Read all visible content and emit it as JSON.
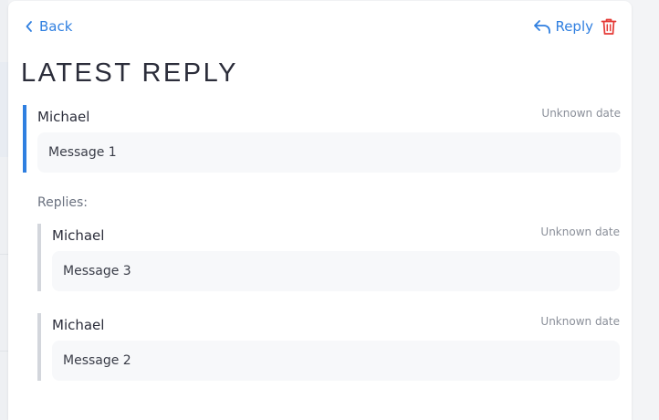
{
  "nav": {
    "back_label": "Back",
    "reply_label": "Reply",
    "accent_color": "#2f7fe0",
    "delete_color": "#e53935",
    "icons": {
      "back": "chevron-left-icon",
      "reply": "reply-arrow-icon",
      "delete": "trash-icon"
    }
  },
  "page": {
    "title": "LATEST REPLY"
  },
  "main_message": {
    "author": "Michael",
    "date": "Unknown date",
    "body": "Message 1"
  },
  "replies_section": {
    "label": "Replies:",
    "items": [
      {
        "author": "Michael",
        "date": "Unknown date",
        "body": "Message 3"
      },
      {
        "author": "Michael",
        "date": "Unknown date",
        "body": "Message 2"
      }
    ]
  }
}
